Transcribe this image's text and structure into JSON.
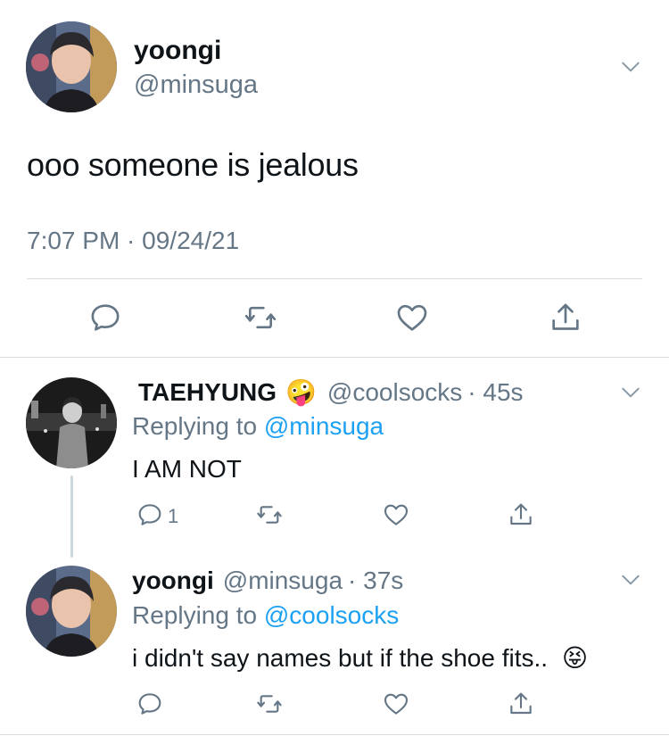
{
  "main_tweet": {
    "name": "yoongi",
    "handle": "@minsuga",
    "text": "ooo someone is jealous",
    "timestamp": "7:07 PM · 09/24/21",
    "avatar": "avatar-yoongi",
    "actions": [
      "reply-icon",
      "retweet-icon",
      "like-icon",
      "share-icon"
    ]
  },
  "replies": [
    {
      "name": "TAEHYUNG",
      "emoji": "🤪",
      "handle": "@coolsocks",
      "time": "· 45s",
      "replying_prefix": "Replying to",
      "replying_to": "@minsuga",
      "text": "I AM NOT",
      "reply_count": "1",
      "avatar": "avatar-taehyung"
    },
    {
      "name": "yoongi",
      "handle": "@minsuga",
      "time": "· 37s",
      "replying_prefix": "Replying to",
      "replying_to": "@coolsocks",
      "text": "i didn't say names but if the shoe fits..",
      "emoji": "😝",
      "avatar": "avatar-yoongi"
    }
  ],
  "colors": {
    "link": "#1da1f2",
    "secondary_text": "#657786",
    "divider": "#d8dde1",
    "icon": "#657786"
  }
}
